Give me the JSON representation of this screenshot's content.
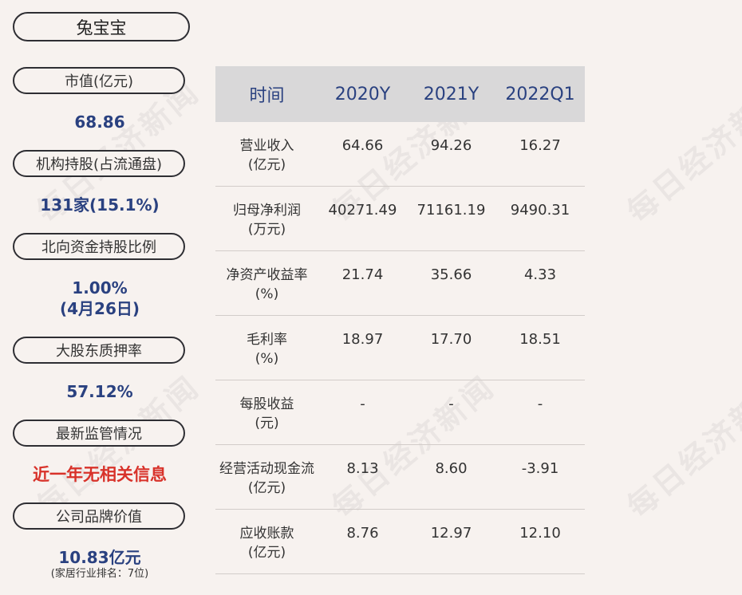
{
  "company": "兔宝宝",
  "market_cap": {
    "label": "市值(亿元)",
    "value": "68.86"
  },
  "institutional": {
    "label": "机构持股(占流通盘)",
    "value": "131家(15.1%)"
  },
  "northbound": {
    "label": "北向资金持股比例",
    "value": "1.00%",
    "date": "(4月26日)"
  },
  "pledge": {
    "label": "大股东质押率",
    "value": "57.12%"
  },
  "regulation": {
    "label": "最新监管情况",
    "value": "近一年无相关信息"
  },
  "brand": {
    "label": "公司品牌价值",
    "value": "10.83亿元",
    "rank": "(家居行业排名：7位)"
  },
  "table": {
    "headers": [
      "时间",
      "2020Y",
      "2021Y",
      "2022Q1"
    ],
    "rows": [
      {
        "label": "营业收入",
        "unit": "(亿元)",
        "values": [
          "64.66",
          "94.26",
          "16.27"
        ]
      },
      {
        "label": "归母净利润",
        "unit": "(万元)",
        "values": [
          "40271.49",
          "71161.19",
          "9490.31"
        ]
      },
      {
        "label": "净资产收益率",
        "unit": "(%)",
        "values": [
          "21.74",
          "35.66",
          "4.33"
        ]
      },
      {
        "label": "毛利率",
        "unit": "(%)",
        "values": [
          "18.97",
          "17.70",
          "18.51"
        ]
      },
      {
        "label": "每股收益",
        "unit": "(元)",
        "values": [
          "-",
          "-",
          "-"
        ]
      },
      {
        "label": "经营活动现金流",
        "unit": "(亿元)",
        "values": [
          "8.13",
          "8.60",
          "-3.91"
        ]
      },
      {
        "label": "应收账款",
        "unit": "(亿元)",
        "values": [
          "8.76",
          "12.97",
          "12.10"
        ]
      }
    ]
  },
  "watermark": "每日经济新闻"
}
